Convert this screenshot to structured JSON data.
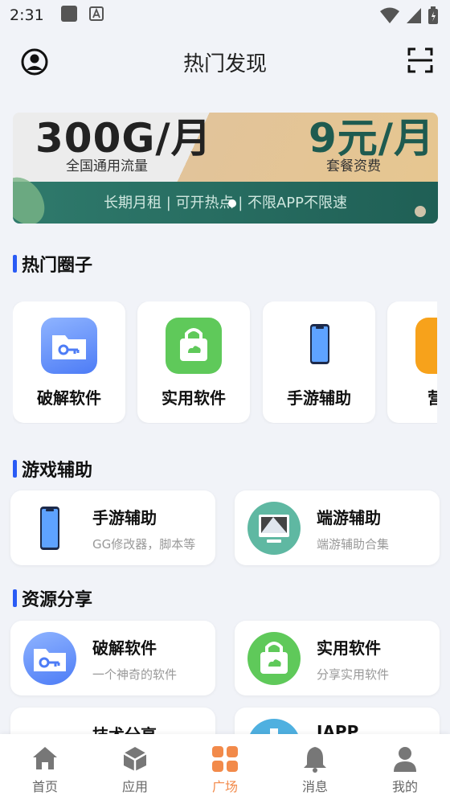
{
  "status": {
    "time": "2:31"
  },
  "header": {
    "title": "热门发现"
  },
  "banner": {
    "big_left": "300G/月",
    "big_right": "9元/月",
    "sub_left": "全国通用流量",
    "sub_right": "套餐资费",
    "slogan": "长期月租 | 可开热点 | 不限APP不限速"
  },
  "sections": {
    "hot_circles": "热门圈子",
    "game_assist": "游戏辅助",
    "resource_share": "资源分享"
  },
  "circles": [
    {
      "label": "破解软件",
      "icon": "folder-key-icon"
    },
    {
      "label": "实用软件",
      "icon": "shopping-bag-icon"
    },
    {
      "label": "手游辅助",
      "icon": "phone-icon"
    },
    {
      "label": "营养",
      "icon": "partial-icon"
    }
  ],
  "game_tiles": [
    {
      "title": "手游辅助",
      "subtitle": "GG修改器，脚本等",
      "icon": "phone-icon"
    },
    {
      "title": "端游辅助",
      "subtitle": "端游辅助合集",
      "icon": "monitor-icon"
    }
  ],
  "resource_tiles": [
    {
      "title": "破解软件",
      "subtitle": "一个神奇的软件",
      "icon": "folder-key-icon"
    },
    {
      "title": "实用软件",
      "subtitle": "分享实用软件",
      "icon": "shopping-bag-icon"
    },
    {
      "title": "技术分享",
      "subtitle": "",
      "icon": "tech-icon"
    },
    {
      "title": "IAPP",
      "subtitle": "",
      "icon": "iapp-icon"
    }
  ],
  "nav": [
    {
      "label": "首页",
      "icon": "home-icon"
    },
    {
      "label": "应用",
      "icon": "cube-icon"
    },
    {
      "label": "广场",
      "icon": "grid-icon"
    },
    {
      "label": "消息",
      "icon": "bell-icon"
    },
    {
      "label": "我的",
      "icon": "person-icon"
    }
  ],
  "colors": {
    "accent": "#2a5bf5",
    "nav_active": "#f28a4a",
    "background": "#f1f3f8"
  }
}
